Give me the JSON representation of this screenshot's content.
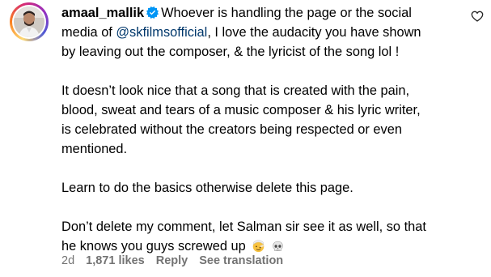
{
  "comment": {
    "username": "amaal_mallik",
    "text_lines_p1": [
      "Whoever is handling the page or the social",
      "media of ",
      "@skfilmsofficial",
      ", I love the audacity you have shown",
      "by leaving out the composer, & the lyricist of the song lol !"
    ],
    "paragraph2": [
      "It doesn’t look nice that a song that is created with the pain,",
      "blood, sweat and tears of a music composer & his lyric writer,",
      "is celebrated without the creators being respected or even",
      "mentioned."
    ],
    "paragraph3": "Learn to do the basics otherwise delete this page.",
    "paragraph4": [
      "Don’t delete my comment, let Salman sir see it as well, so that",
      "he knows you guys screwed up"
    ],
    "emojis": [
      "face-with-head-bandage-icon",
      "skull-icon"
    ]
  },
  "meta": {
    "age": "2d",
    "likes": "1,871 likes",
    "reply": "Reply",
    "see_translation": "See translation"
  },
  "colors": {
    "mention": "#00376b",
    "meta": "#737373",
    "verified": "#0095f6"
  }
}
